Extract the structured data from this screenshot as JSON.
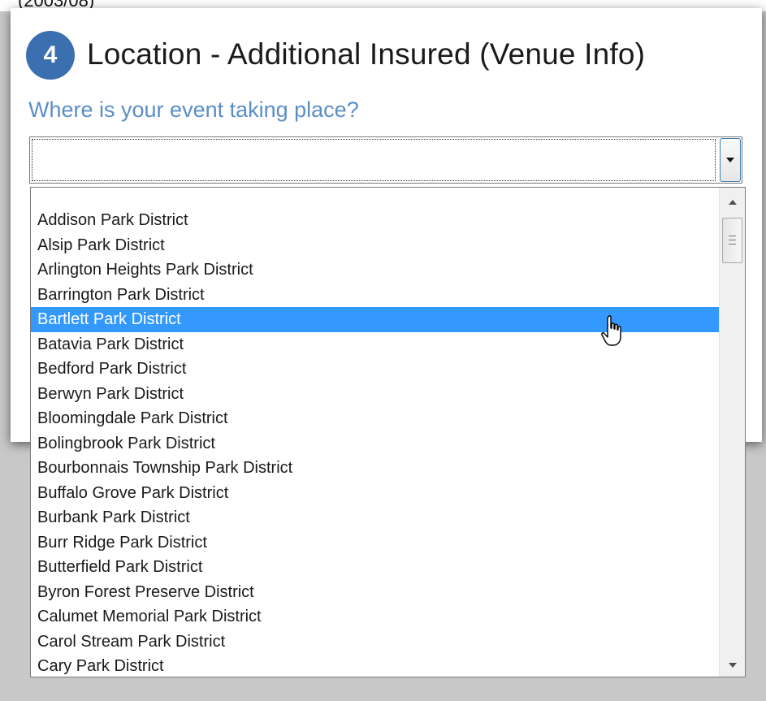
{
  "background_text": "(2003/08)",
  "step": {
    "number": "4",
    "title": "Location - Additional Insured (Venue Info)"
  },
  "question": "Where is your event taking place?",
  "venue_select": {
    "value": "",
    "arrow_icon": "chevron-down-icon"
  },
  "dropdown": {
    "selected_index": 4,
    "options": [
      "Addison Park District",
      "Alsip Park District",
      "Arlington Heights Park District",
      "Barrington Park District",
      "Bartlett Park District",
      "Batavia Park District",
      "Bedford Park District",
      "Berwyn Park District",
      "Bloomingdale Park District",
      "Bolingbrook Park District",
      "Bourbonnais Township Park District",
      "Buffalo Grove Park District",
      "Burbank Park District",
      "Burr Ridge Park District",
      "Butterfield Park District",
      "Byron Forest Preserve District",
      "Calumet Memorial Park District",
      "Carol Stream Park District",
      "Cary Park District"
    ],
    "scroll_position_fraction": 0.03
  },
  "colors": {
    "badge": "#3b6fb0",
    "question_text": "#5a8ec7",
    "selected_option": "#3399ff",
    "page_background": "#c8c8c8"
  }
}
